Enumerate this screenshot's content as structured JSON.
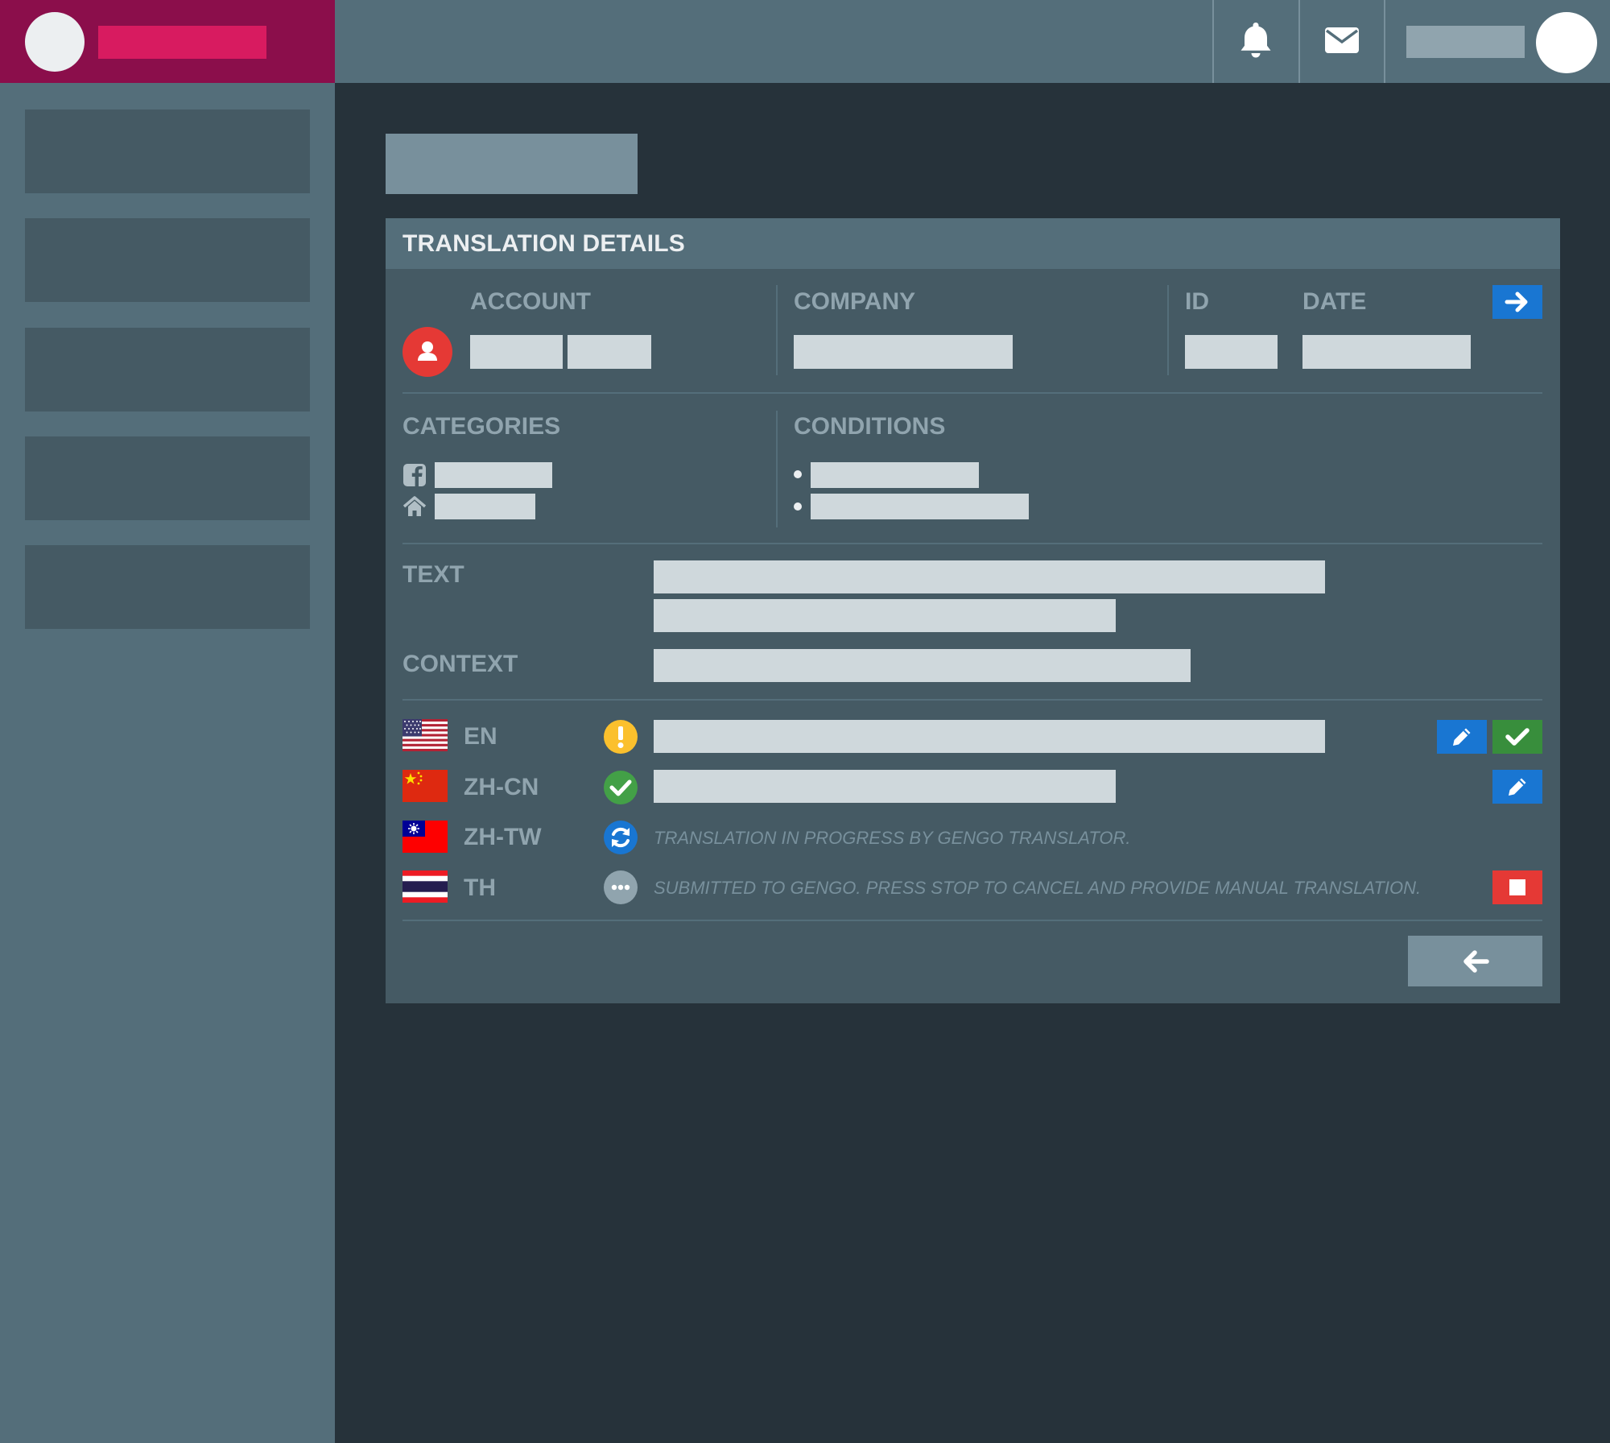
{
  "panel": {
    "title": "TRANSLATION DETAILS"
  },
  "info": {
    "account_label": "ACCOUNT",
    "company_label": "COMPANY",
    "id_label": "ID",
    "date_label": "DATE",
    "categories_label": "CATEGORIES",
    "conditions_label": "CONDITIONS",
    "text_label": "TEXT",
    "context_label": "CONTEXT"
  },
  "languages": [
    {
      "code": "EN",
      "status_icon": "warning-icon",
      "actions": [
        "edit-icon",
        "check-icon"
      ]
    },
    {
      "code": "ZH-CN",
      "status_icon": "check-icon",
      "actions": [
        "edit-icon"
      ]
    },
    {
      "code": "ZH-TW",
      "status_icon": "refresh-icon",
      "message": "TRANSLATION IN PROGRESS BY GENGO TRANSLATOR.",
      "actions": []
    },
    {
      "code": "TH",
      "status_icon": "more-icon",
      "message": "SUBMITTED TO GENGO. PRESS STOP TO CANCEL AND PROVIDE MANUAL TRANSLATION.",
      "actions": [
        "stop-icon"
      ]
    }
  ],
  "colors": {
    "brand": "#8b0e4b",
    "brand_accent": "#d81b60",
    "topbar": "#546e7a",
    "background": "#26323a",
    "panel": "#455a64",
    "primary": "#1976d2",
    "success": "#388e3c",
    "danger": "#e53935",
    "warning": "#fbc02d"
  }
}
